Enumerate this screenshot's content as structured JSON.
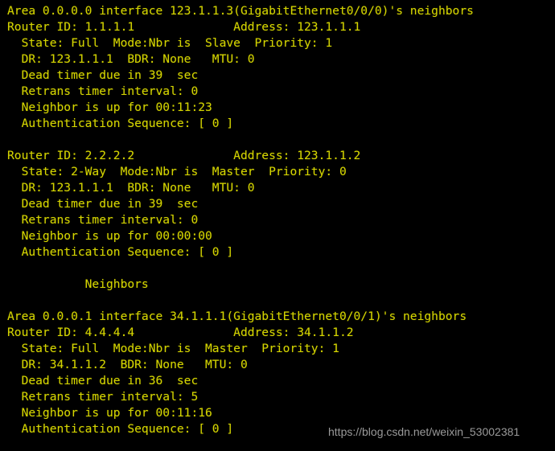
{
  "terminal": {
    "background_color": "#000000",
    "text_color": "#d4d400",
    "watermark_color": "#9a9a9a",
    "watermark": "https://blog.csdn.net/weixin_53002381",
    "lines": [
      "Area 0.0.0.0 interface 123.1.1.3(GigabitEthernet0/0/0)'s neighbors",
      "Router ID: 1.1.1.1              Address: 123.1.1.1",
      "  State: Full  Mode:Nbr is  Slave  Priority: 1",
      "  DR: 123.1.1.1  BDR: None   MTU: 0",
      "  Dead timer due in 39  sec",
      "  Retrans timer interval: 0",
      "  Neighbor is up for 00:11:23",
      "  Authentication Sequence: [ 0 ]",
      "",
      "Router ID: 2.2.2.2              Address: 123.1.1.2",
      "  State: 2-Way  Mode:Nbr is  Master  Priority: 0",
      "  DR: 123.1.1.1  BDR: None   MTU: 0",
      "  Dead timer due in 39  sec",
      "  Retrans timer interval: 0",
      "  Neighbor is up for 00:00:00",
      "  Authentication Sequence: [ 0 ]",
      "",
      "           Neighbors",
      "",
      "Area 0.0.0.1 interface 34.1.1.1(GigabitEthernet0/0/1)'s neighbors",
      "Router ID: 4.4.4.4              Address: 34.1.1.2",
      "  State: Full  Mode:Nbr is  Master  Priority: 1",
      "  DR: 34.1.1.2  BDR: None   MTU: 0",
      "  Dead timer due in 36  sec",
      "  Retrans timer interval: 5",
      "  Neighbor is up for 00:11:16",
      "  Authentication Sequence: [ 0 ]"
    ],
    "neighbor_blocks": [
      {
        "area": "0.0.0.0",
        "interface_ip": "123.1.1.3",
        "interface_name": "GigabitEthernet0/0/0",
        "neighbors": [
          {
            "router_id": "1.1.1.1",
            "address": "123.1.1.1",
            "state": "Full",
            "mode": "Nbr is  Slave",
            "priority": "1",
            "dr": "123.1.1.1",
            "bdr": "None",
            "mtu": "0",
            "dead_timer": "39",
            "retrans_timer_interval": "0",
            "neighbor_up_for": "00:11:23",
            "authentication_sequence": "[ 0 ]"
          },
          {
            "router_id": "2.2.2.2",
            "address": "123.1.1.2",
            "state": "2-Way",
            "mode": "Nbr is  Master",
            "priority": "0",
            "dr": "123.1.1.1",
            "bdr": "None",
            "mtu": "0",
            "dead_timer": "39",
            "retrans_timer_interval": "0",
            "neighbor_up_for": "00:00:00",
            "authentication_sequence": "[ 0 ]"
          }
        ]
      },
      {
        "section_header": "Neighbors",
        "area": "0.0.0.1",
        "interface_ip": "34.1.1.1",
        "interface_name": "GigabitEthernet0/0/1",
        "neighbors": [
          {
            "router_id": "4.4.4.4",
            "address": "34.1.1.2",
            "state": "Full",
            "mode": "Nbr is  Master",
            "priority": "1",
            "dr": "34.1.1.2",
            "bdr": "None",
            "mtu": "0",
            "dead_timer": "36",
            "retrans_timer_interval": "5",
            "neighbor_up_for": "00:11:16",
            "authentication_sequence": "[ 0 ]"
          }
        ]
      }
    ]
  }
}
